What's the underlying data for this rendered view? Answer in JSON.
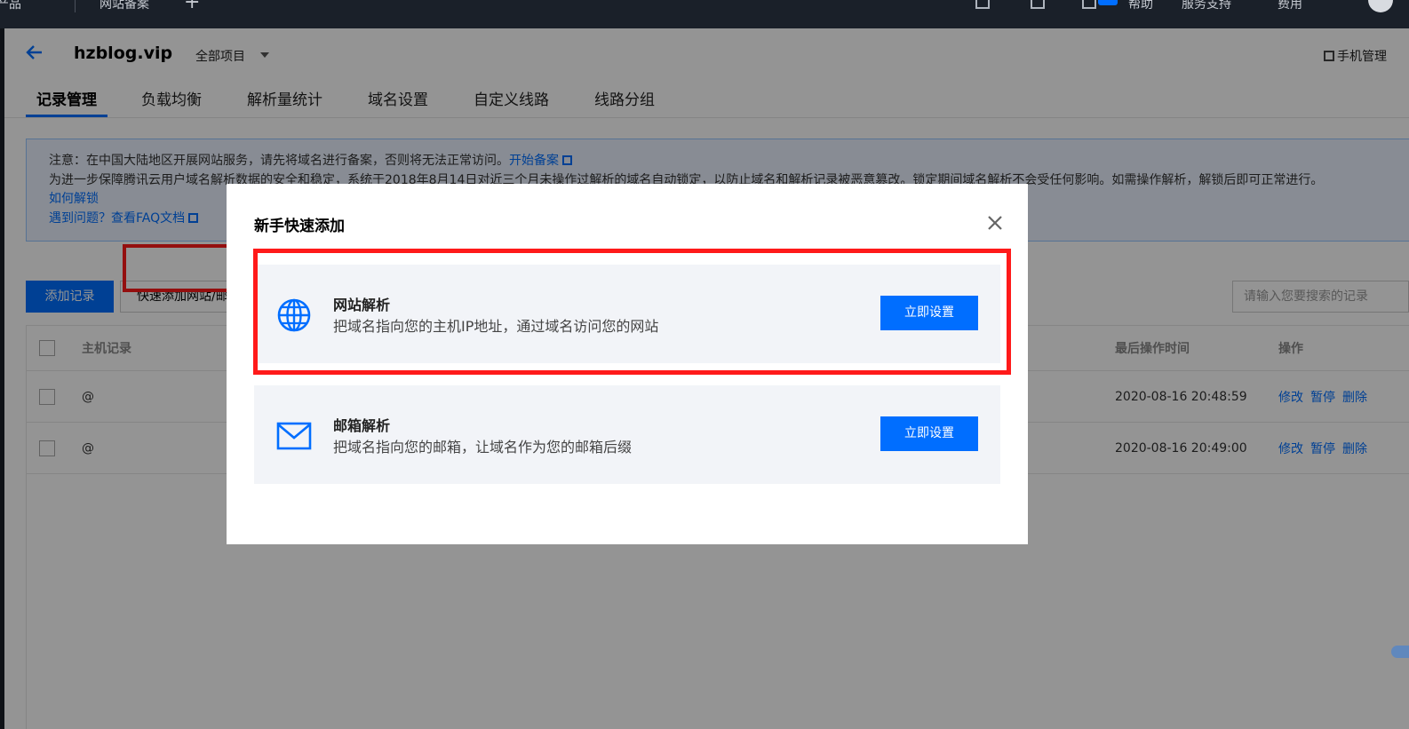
{
  "topnav": {
    "products": "产品",
    "beian": "网站备案",
    "help": "帮助",
    "support": "服务支持",
    "billing": "费用"
  },
  "header": {
    "domain": "hzblog.vip",
    "project": "全部项目",
    "mobile": "手机管理"
  },
  "tabs": [
    "记录管理",
    "负载均衡",
    "解析量统计",
    "域名设置",
    "自定义线路",
    "线路分组"
  ],
  "notice": {
    "line1_text": "注意：在中国大陆地区开展网站服务，请先将域名进行备案，否则将无法正常访问。",
    "line1_link": "开始备案",
    "line2_text": "为进一步保障腾讯云用户域名解析数据的安全和稳定，系统于2018年8月14日对近三个月未操作过解析的域名自动锁定，以防止域名和解析记录被恶意篡改。锁定期间域名解析不会受任何影响。如需操作解析，解锁后即可正常进行。",
    "line3_link": "如何解锁",
    "line4_text": "遇到问题？",
    "line4_link": "查看FAQ文档"
  },
  "toolbar": {
    "add_record": "添加记录",
    "quick_add": "快速添加网站/邮",
    "search_placeholder": "请输入您要搜索的记录"
  },
  "table": {
    "columns": {
      "host": "主机记录",
      "last_op_time": "最后操作时间",
      "action": "操作"
    },
    "rows": [
      {
        "host": "@",
        "time": "2020-08-16 20:48:59",
        "edit": "修改",
        "pause": "暂停",
        "delete": "删除"
      },
      {
        "host": "@",
        "time": "2020-08-16 20:49:00",
        "edit": "修改",
        "pause": "暂停",
        "delete": "删除"
      }
    ]
  },
  "modal": {
    "title": "新手快速添加",
    "cards": [
      {
        "title": "网站解析",
        "desc": "把域名指向您的主机IP地址，通过域名访问您的网站",
        "button": "立即设置",
        "icon": "globe-icon"
      },
      {
        "title": "邮箱解析",
        "desc": "把域名指向您的邮箱，让域名作为您的邮箱后缀",
        "button": "立即设置",
        "icon": "mail-icon"
      }
    ]
  },
  "colors": {
    "accent": "#006eff",
    "highlight": "#ff1a1a",
    "topbar": "#1a2029"
  }
}
